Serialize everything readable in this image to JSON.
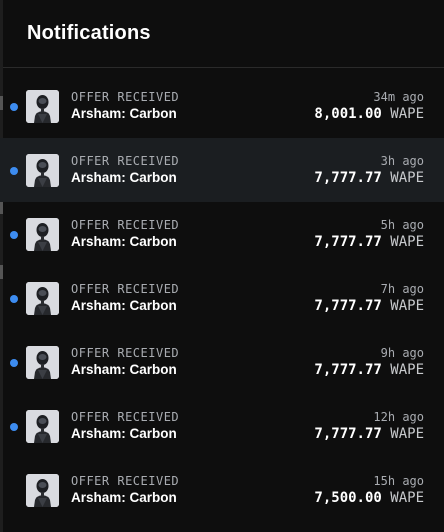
{
  "header": {
    "title": "Notifications"
  },
  "notifications": [
    {
      "type": "OFFER RECEIVED",
      "item": "Arsham: Carbon",
      "time": "34m ago",
      "amount": "8,001.00",
      "currency": "WAPE",
      "unread": true,
      "highlighted": false
    },
    {
      "type": "OFFER RECEIVED",
      "item": "Arsham: Carbon",
      "time": "3h ago",
      "amount": "7,777.77",
      "currency": "WAPE",
      "unread": true,
      "highlighted": true
    },
    {
      "type": "OFFER RECEIVED",
      "item": "Arsham: Carbon",
      "time": "5h ago",
      "amount": "7,777.77",
      "currency": "WAPE",
      "unread": true,
      "highlighted": false
    },
    {
      "type": "OFFER RECEIVED",
      "item": "Arsham: Carbon",
      "time": "7h ago",
      "amount": "7,777.77",
      "currency": "WAPE",
      "unread": true,
      "highlighted": false
    },
    {
      "type": "OFFER RECEIVED",
      "item": "Arsham: Carbon",
      "time": "9h ago",
      "amount": "7,777.77",
      "currency": "WAPE",
      "unread": true,
      "highlighted": false
    },
    {
      "type": "OFFER RECEIVED",
      "item": "Arsham: Carbon",
      "time": "12h ago",
      "amount": "7,777.77",
      "currency": "WAPE",
      "unread": true,
      "highlighted": false
    },
    {
      "type": "OFFER RECEIVED",
      "item": "Arsham: Carbon",
      "time": "15h ago",
      "amount": "7,500.00",
      "currency": "WAPE",
      "unread": false,
      "highlighted": false
    }
  ],
  "colors": {
    "unread_dot": "#3d8cf0",
    "background": "#0e0e0e",
    "highlight_row": "#1b1e21"
  },
  "icons": {
    "avatar": "robot-avatar-icon",
    "unread": "unread-dot-icon"
  }
}
